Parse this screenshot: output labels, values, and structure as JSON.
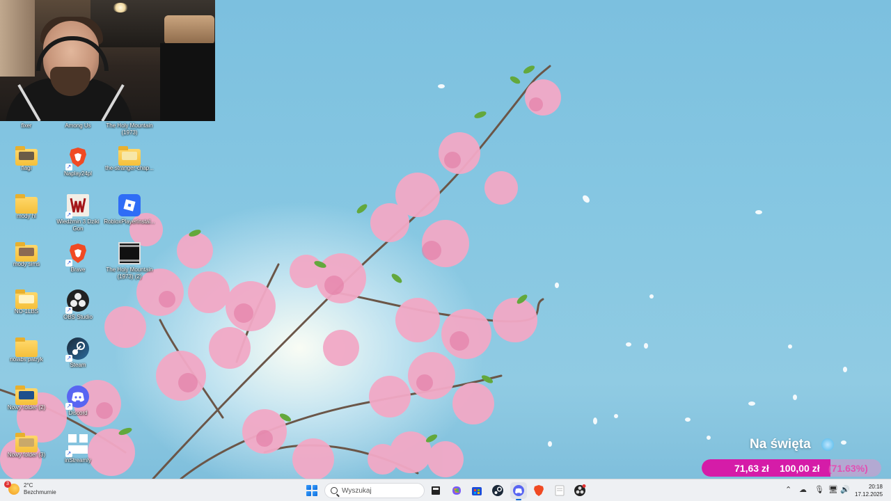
{
  "desktop": {
    "icons": [
      {
        "label": "fixer",
        "icon": "folder-icon"
      },
      {
        "label": "Among Us",
        "icon": "among-us-icon"
      },
      {
        "label": "The Holy Mountain (1973)",
        "icon": "video-icon"
      },
      {
        "label": "flagi",
        "icon": "folder-icon"
      },
      {
        "label": "Naplay24pl",
        "icon": "brave-icon"
      },
      {
        "label": "the-stranger-chap...",
        "icon": "folder-icon"
      },
      {
        "label": "mody hl",
        "icon": "folder-icon"
      },
      {
        "label": "Wiedźmin 3 Dziki Gon",
        "icon": "witcher-icon"
      },
      {
        "label": "RobloxPlayerInstal...",
        "icon": "roblox-icon"
      },
      {
        "label": "mody sims",
        "icon": "folder-icon"
      },
      {
        "label": "Brave",
        "icon": "brave-icon"
      },
      {
        "label": "The Holy Mountain (1973) (2)",
        "icon": "video-icon"
      },
      {
        "label": "NO-1LBS",
        "icon": "folder-icon"
      },
      {
        "label": "OBS Studio",
        "icon": "obs-icon"
      },
      {
        "label": "nolabs patryk",
        "icon": "folder-icon"
      },
      {
        "label": "Steam",
        "icon": "steam-icon"
      },
      {
        "label": "Nowy folder (2)",
        "icon": "folder-icon"
      },
      {
        "label": "Discord",
        "icon": "discord-icon"
      },
      {
        "label": "Nowy folder (3)",
        "icon": "folder-icon"
      },
      {
        "label": "inStreamly",
        "icon": "instreamly-icon"
      }
    ]
  },
  "donation_goal": {
    "title": "Na święta",
    "current": "71,63 zł",
    "target": "100,00 zł",
    "percent_label": "(71.63%)",
    "progress": 0.7163,
    "colors": {
      "fill": "#d51ca8",
      "track": "#dc96c8"
    }
  },
  "taskbar": {
    "weather": {
      "temp": "2°C",
      "desc": "Bezchmurnie",
      "badge": "3"
    },
    "search_placeholder": "Wyszukaj",
    "apps": [
      "file-explorer-icon",
      "copilot-icon",
      "microsoft-store-icon",
      "steam-icon",
      "discord-icon",
      "brave-icon",
      "notepad-icon",
      "obs-icon"
    ],
    "tray": [
      "chevron-up-icon",
      "onedrive-icon",
      "microphone-icon",
      "network-icon",
      "volume-icon"
    ],
    "time": "20:18",
    "date": "17.12.2025"
  },
  "colors": {
    "accent": "#0c6ad8",
    "taskbar_bg": "#eef0f3"
  }
}
